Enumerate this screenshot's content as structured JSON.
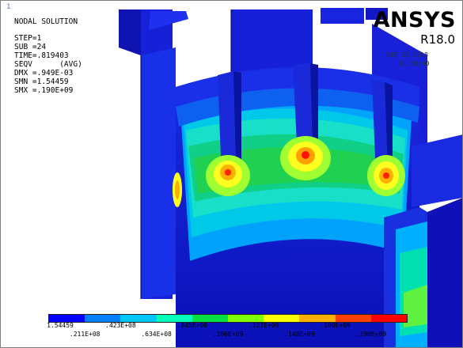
{
  "viewport": {
    "window_number": "1"
  },
  "plot_info": {
    "lines": [
      "NODAL SOLUTION",
      "",
      "STEP=1",
      "SUB =24",
      "TIME=.819403",
      "SEQV      (AVG)",
      "DMX =.949E-03",
      "SMN =1.54459",
      "SMX =.190E+09"
    ]
  },
  "logo": {
    "word": "ANSYS",
    "version": "R18.0"
  },
  "timestamp": {
    "date": "SEP 28 2018",
    "time": "11:55:40"
  },
  "legend": {
    "colors": [
      "#0000ff",
      "#0080ff",
      "#00c8ff",
      "#00ffb8",
      "#00e040",
      "#80ff00",
      "#ffff00",
      "#ffb000",
      "#ff4000",
      "#ff0000"
    ],
    "labels_row1": [
      "1.54459",
      ".423E+08",
      ".845E+08",
      ".127E+09",
      ".169E+09"
    ],
    "labels_row2": [
      ".211E+08",
      ".634E+08",
      ".106E+09",
      ".148E+09",
      ".190E+09"
    ]
  },
  "colors": {
    "model_blue": "#1418d8",
    "background": "#ffffff"
  }
}
